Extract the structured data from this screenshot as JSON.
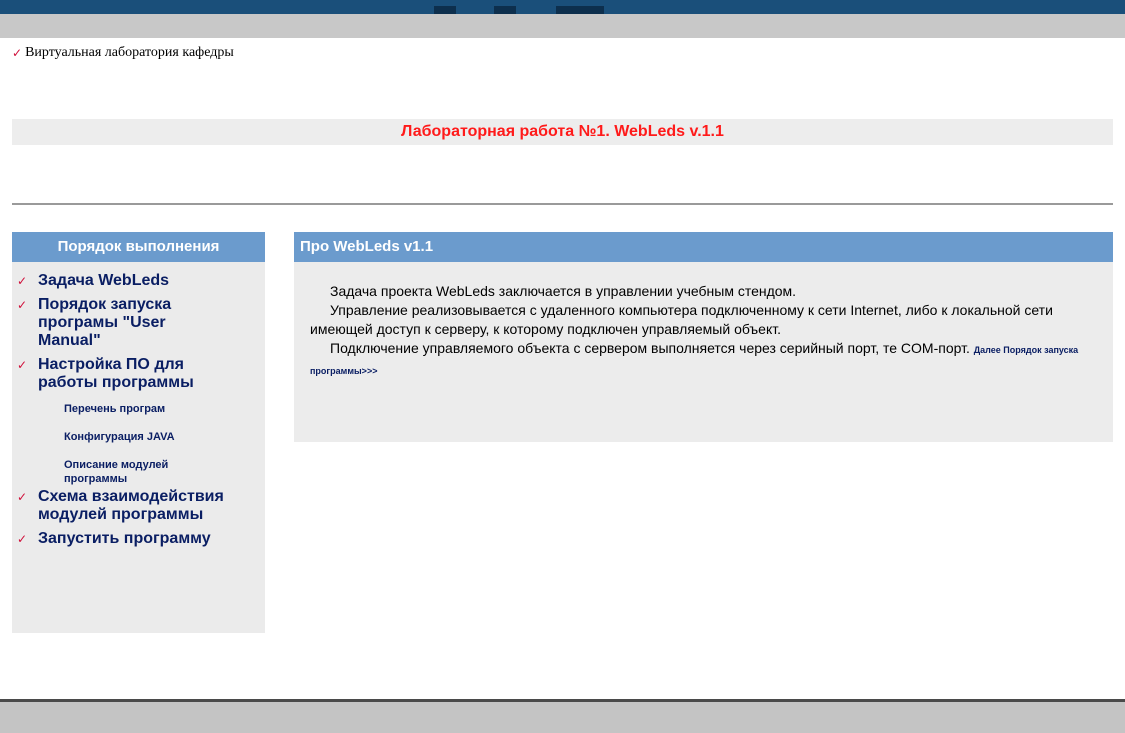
{
  "breadcrumb": {
    "check": "✓",
    "label": "Виртуальная лаборатория кафедры"
  },
  "title": "Лабораторная работа №1. WebLeds v.1.1",
  "sidebar": {
    "header": "Порядок выполнения",
    "items": [
      {
        "check": "✓",
        "label": "Задача WebLeds"
      },
      {
        "check": "✓",
        "label": "Порядок запуска програмы \"User Manual\""
      },
      {
        "check": "✓",
        "label": "Настройка ПО для работы программы"
      },
      {
        "label": "Перечень програм"
      },
      {
        "label": "Конфигурация JAVA"
      },
      {
        "label": "Описание модулей программы"
      },
      {
        "check": "✓",
        "label": "Схема взаимодействия модулей программы"
      },
      {
        "check": "✓",
        "label": "Запустить программу"
      }
    ]
  },
  "panel": {
    "header": "Про WebLeds v1.1",
    "p1": "Задача проекта WebLeds заключается в управлении учебным стендом.",
    "p2": "Управление реализовывается с удаленного компьютера подключенному к сети Internet, либо к локальной сети имеющей доступ к серверу, к которому подключен управляемый объект.",
    "p3": "Подключение управляемого объекта с сервером выполняется через серийный порт, те COM-порт.",
    "more_link": "Далее Порядок запуска программы>>>"
  },
  "colors": {
    "title_red": "#ff1a1a",
    "header_blue": "#6b9bcd",
    "link_navy": "#0a1e63",
    "top_bar": "#1a4f7a"
  }
}
